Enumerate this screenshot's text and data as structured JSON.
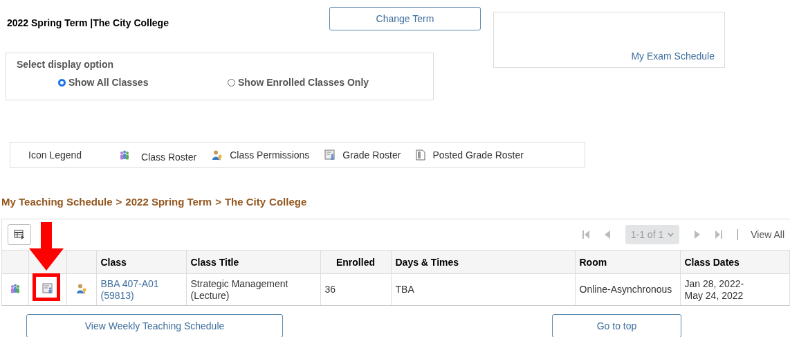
{
  "header": {
    "term": "2022 Spring Term",
    "separator": "|",
    "institution": "The City College",
    "change_term_button": "Change Term"
  },
  "exam_panel": {
    "link": "My Exam Schedule"
  },
  "display_option": {
    "title": "Select display option",
    "options": [
      {
        "label": "Show All Classes",
        "selected": true
      },
      {
        "label": "Show Enrolled Classes Only",
        "selected": false
      }
    ]
  },
  "icon_legend": {
    "title": "Icon Legend",
    "items": [
      {
        "kind": "roster",
        "label": "Class Roster"
      },
      {
        "kind": "permissions",
        "label": "Class Permissions"
      },
      {
        "kind": "grade",
        "label": "Grade Roster"
      },
      {
        "kind": "posted",
        "label": "Posted Grade Roster"
      }
    ]
  },
  "breadcrumb": {
    "parts": [
      "My Teaching Schedule",
      ">",
      "2022 Spring Term",
      ">",
      "The City",
      "College"
    ]
  },
  "grid": {
    "pagination": {
      "range": "1-1 of 1",
      "view_all": "View All"
    },
    "columns": [
      "Class",
      "Class Title",
      "Enrolled",
      "Days & Times",
      "Room",
      "Class Dates"
    ],
    "rows": [
      {
        "icons": [
          {
            "kind": "roster",
            "highlighted": false
          },
          {
            "kind": "grade",
            "highlighted": true
          },
          {
            "kind": "permissions",
            "highlighted": false
          }
        ],
        "class": [
          "BBA 407-A01",
          "(59813)"
        ],
        "title": [
          "Strategic Management",
          "(Lecture)"
        ],
        "enrolled": "36",
        "days_times": "TBA",
        "room": "Online-Asynchronous",
        "dates": [
          "Jan 28, 2022-",
          "May 24, 2022"
        ]
      }
    ]
  },
  "footer_buttons": [
    "View Weekly Teaching Schedule",
    "Go to top"
  ]
}
